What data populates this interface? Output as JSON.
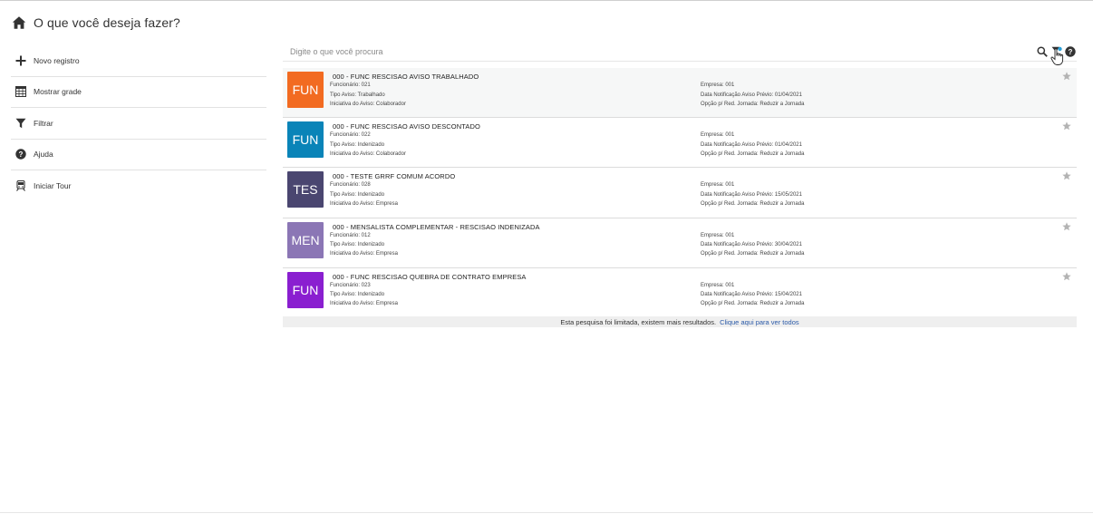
{
  "header": {
    "title": "O que você deseja fazer?",
    "icon": "home-icon"
  },
  "sidebar": {
    "items": [
      {
        "label": "Novo registro",
        "icon": "plus-icon"
      },
      {
        "label": "Mostrar grade",
        "icon": "table-icon"
      },
      {
        "label": "Filtrar",
        "icon": "filter-icon"
      },
      {
        "label": "Ajuda",
        "icon": "help-icon"
      },
      {
        "label": "Iniciar Tour",
        "icon": "train-icon"
      }
    ]
  },
  "search": {
    "placeholder": "Digite o que você procura",
    "value": ""
  },
  "results": [
    {
      "badge": "FUN",
      "color": "#f26b21",
      "title": "000 - FUNC RESCISAO AVISO TRABALHADO",
      "left": [
        "Funcionário: 021",
        "Tipo Aviso: Trabalhado",
        "Iniciativa do Aviso: Colaborador"
      ],
      "right": [
        "Empresa: 001",
        "Data Notificação Aviso Prévio: 01/04/2021",
        "Opção p/ Red. Jornada: Reduzir a Jornada"
      ]
    },
    {
      "badge": "FUN",
      "color": "#0a84b8",
      "title": "000 - FUNC RESCISAO AVISO DESCONTADO",
      "left": [
        "Funcionário: 022",
        "Tipo Aviso: Indenizado",
        "Iniciativa do Aviso: Colaborador"
      ],
      "right": [
        "Empresa: 001",
        "Data Notificação Aviso Prévio: 01/04/2021",
        "Opção p/ Red. Jornada: Reduzir a Jornada"
      ]
    },
    {
      "badge": "TES",
      "color": "#4a4670",
      "title": "000 - TESTE GRRF COMUM ACORDO",
      "left": [
        "Funcionário: 028",
        "Tipo Aviso: Indenizado",
        "Iniciativa do Aviso: Empresa"
      ],
      "right": [
        "Empresa: 001",
        "Data Notificação Aviso Prévio: 15/05/2021",
        "Opção p/ Red. Jornada: Reduzir a Jornada"
      ]
    },
    {
      "badge": "MEN",
      "color": "#8b76b5",
      "title": "000 - MENSALISTA COMPLEMENTAR - RESCISAO INDENIZADA",
      "left": [
        "Funcionário: 012",
        "Tipo Aviso: Indenizado",
        "Iniciativa do Aviso: Empresa"
      ],
      "right": [
        "Empresa: 001",
        "Data Notificação Aviso Prévio: 30/04/2021",
        "Opção p/ Red. Jornada: Reduzir a Jornada"
      ]
    },
    {
      "badge": "FUN",
      "color": "#8a1fd0",
      "title": "000 - FUNC RESCISAO QUEBRA DE CONTRATO EMPRESA",
      "left": [
        "Funcionário: 023",
        "Tipo Aviso: Indenizado",
        "Iniciativa do Aviso: Empresa"
      ],
      "right": [
        "Empresa: 001",
        "Data Notificação Aviso Prévio: 15/04/2021",
        "Opção p/ Red. Jornada: Reduzir a Jornada"
      ]
    }
  ],
  "footer": {
    "message": "Esta pesquisa foi limitada, existem mais resultados.",
    "link": "Clique aqui para ver todos"
  }
}
